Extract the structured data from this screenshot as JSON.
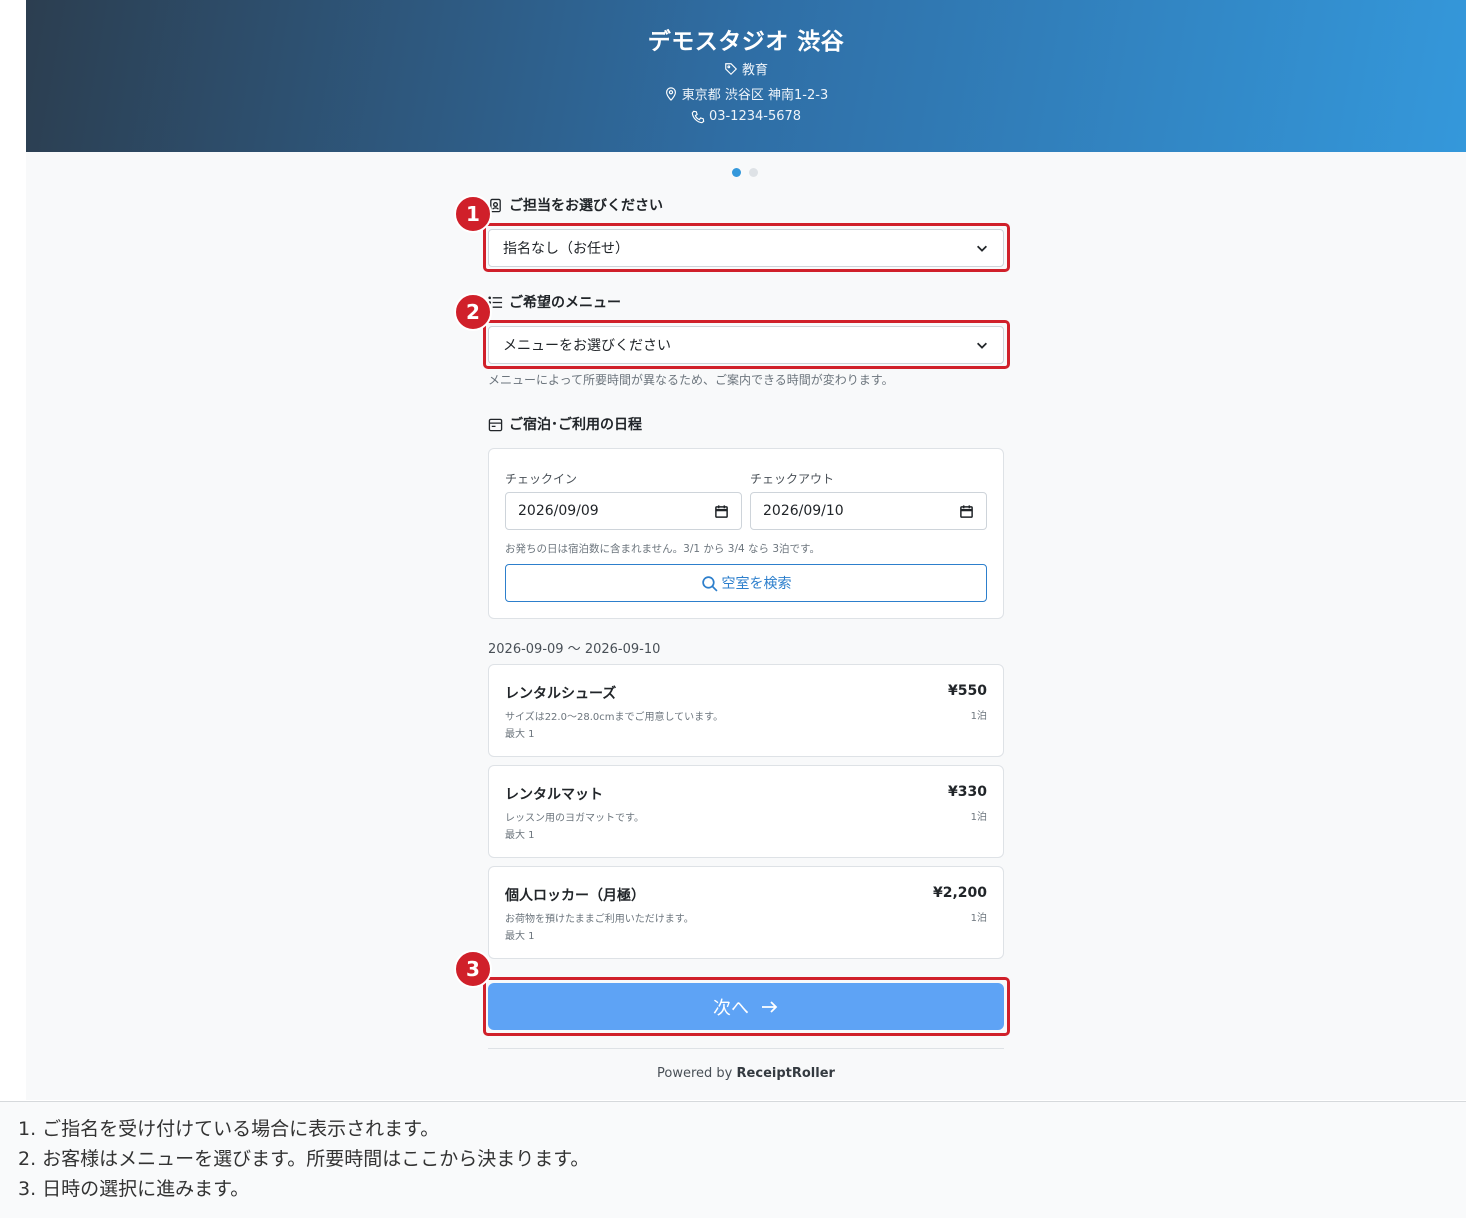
{
  "header": {
    "title": "デモスタジオ 渋谷",
    "category": "教育",
    "address": "東京都 渋谷区 神南1-2-3",
    "phone": "03-1234-5678",
    "category_icon": "tag-icon",
    "address_icon": "map-pin-icon",
    "phone_icon": "phone-icon"
  },
  "carousel": {
    "total": 2,
    "active": 1
  },
  "staff": {
    "label": "ご担当をお選びください",
    "value": "指名なし（お任せ）"
  },
  "menu": {
    "label": "ご希望のメニュー",
    "value": "メニューをお選びください",
    "hint": "メニューによって所要時間が異なるため、ご案内できる時間が変わります。"
  },
  "schedule": {
    "label": "ご宿泊･ご利用の日程",
    "checkin_label": "チェックイン",
    "checkin_value": "2026/09/09",
    "checkout_label": "チェックアウト",
    "checkout_value": "2026/09/10",
    "note": "お発ちの日は宿泊数に含まれません。3/1 から 3/4 なら 3泊です。",
    "search_label": "空室を検索"
  },
  "results": {
    "range": "2026-09-09 〜 2026-09-10",
    "items": [
      {
        "name": "レンタルシューズ",
        "desc": "サイズは22.0〜28.0cmまでご用意しています。",
        "max": "最大 1",
        "price": "¥550",
        "unit": "1泊"
      },
      {
        "name": "レンタルマット",
        "desc": "レッスン用のヨガマットです。",
        "max": "最大 1",
        "price": "¥330",
        "unit": "1泊"
      },
      {
        "name": "個人ロッカー（月極）",
        "desc": "お荷物を預けたままご利用いただけます。",
        "max": "最大 1",
        "price": "¥2,200",
        "unit": "1泊"
      }
    ]
  },
  "next_button": {
    "label": "次へ"
  },
  "footer": {
    "powered_prefix": "Powered by",
    "brand": "ReceiptRoller"
  },
  "annotations": {
    "badges": [
      "1",
      "2",
      "3"
    ],
    "color": "#d0202a",
    "notes": [
      "1. ご指名を受け付けている場合に表示されます。",
      "2. お客様はメニューを選びます。所要時間はここから決まります。",
      "3. 日時の選択に進みます。"
    ]
  },
  "colors": {
    "accent": "#3498db",
    "button": "#5ea3f5",
    "link": "#2d7fcc"
  }
}
